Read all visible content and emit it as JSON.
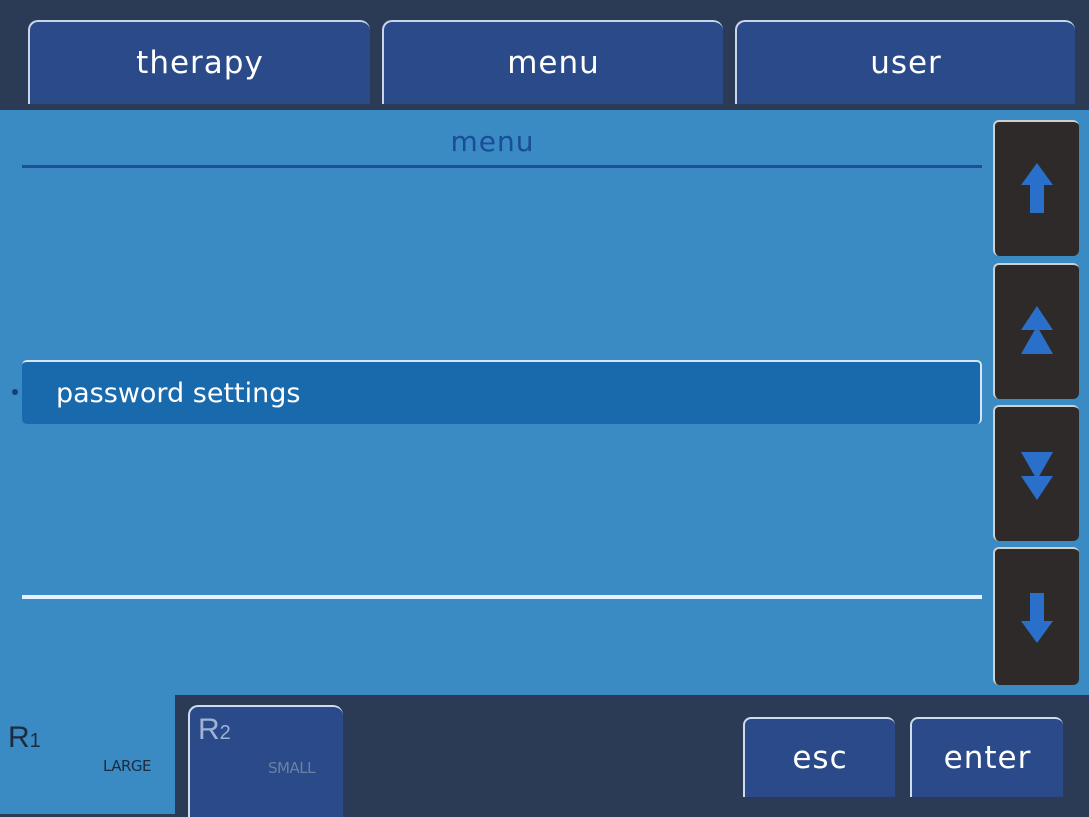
{
  "tabs": [
    {
      "label": "therapy"
    },
    {
      "label": "menu"
    },
    {
      "label": "user"
    }
  ],
  "panel": {
    "title": "menu",
    "items": [
      {
        "label": "password settings"
      }
    ]
  },
  "scroll_buttons": [
    {
      "icon": "arrow-up-icon"
    },
    {
      "icon": "page-up-icon"
    },
    {
      "icon": "page-down-icon"
    },
    {
      "icon": "arrow-down-icon"
    }
  ],
  "bottom": {
    "r1": {
      "prefix": "R",
      "index": "1",
      "size": "LARGE"
    },
    "r2": {
      "prefix": "R",
      "index": "2",
      "size": "SMALL"
    },
    "esc_label": "esc",
    "enter_label": "enter"
  },
  "colors": {
    "frame": "#2b3b55",
    "panel": "#3a8ac4",
    "tab": "#2b4a8a",
    "selected_row": "#1969ad",
    "arrow": "#2a6fc9",
    "side_button": "#2d2a29"
  }
}
